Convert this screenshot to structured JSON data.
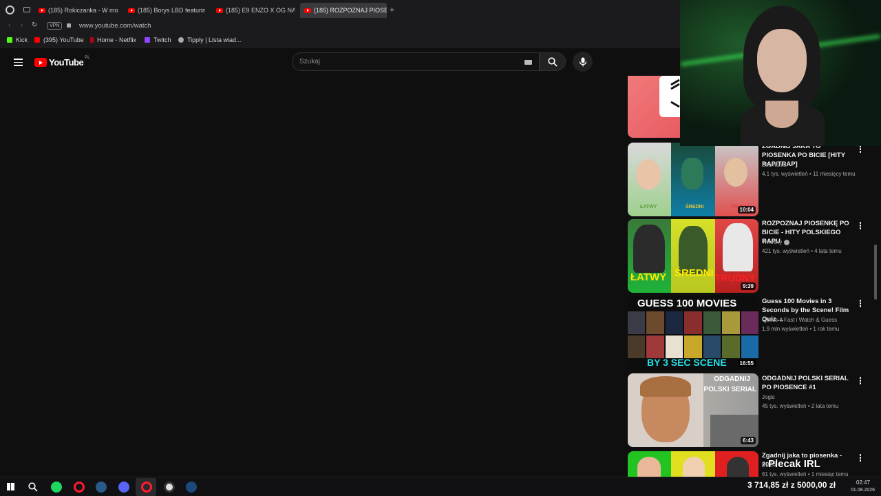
{
  "browser": {
    "tabs": [
      {
        "label": "(185) Rokiczanka - W moim"
      },
      {
        "label": "(185) Borys LBD featuring I"
      },
      {
        "label": "(185) E9 ENZO X OG NAFA"
      },
      {
        "label": "(185) ROZPOZNAJ PIOSEN"
      }
    ],
    "vpn_label": "VPN",
    "url": "www.youtube.com/watch",
    "bookmarks": [
      "Kick",
      "(395) YouTube",
      "Home - Netflix",
      "Twitch",
      "Tipply | Lista wiad..."
    ]
  },
  "youtube": {
    "logo_text": "YouTube",
    "region": "PL",
    "search_placeholder": "Szukaj"
  },
  "videos": [
    {
      "title": "ZGADNIJ JAKA TO PIOSENKA PO BICIE [HITY RAP/TRAP]",
      "channel": "Bitomania",
      "meta": "4,1 tys. wyświetleń • 11 miesięcy temu",
      "duration": "10:04",
      "thumb_labels": [
        "ŁATWY",
        "ŚREDNI",
        "TRUDNY"
      ]
    },
    {
      "title": "ROZPOZNAJ PIOSENKĘ PO BICIE - HITY POLSKIEGO RAPU",
      "channel": "Threeny",
      "meta": "421 tys. wyświetleń • 4 lata temu",
      "duration": "9:39",
      "thumb_labels": [
        "ŁATWY",
        "ŚREDNI",
        "TRUDNY"
      ]
    },
    {
      "title": "Guess 100 Movies in 3 Seconds by the Scene! Film Quiz ...",
      "channel": "Guess It Fast i Watch & Guess",
      "meta": "1,9 mln wyświetleń • 1 rok temu",
      "duration": "16:55",
      "thumb_labels": [
        "GUESS 100 MOVIES",
        "BY 3 SEC SCENE"
      ]
    },
    {
      "title": "ODGADNIJ POLSKI SERIAL PO PIOSENCE #1",
      "channel": "Jogis",
      "meta": "45 tys. wyświetleń • 2 lata temu",
      "duration": "6:43",
      "thumb_labels": [
        "ODGADNIJ",
        "POLSKI SERIAL"
      ]
    },
    {
      "title": "Zgadnij jaka to piosenka - 2025",
      "channel": "PM",
      "meta": "61 tys. wyświetleń • 1 miesiąc temu",
      "duration": "",
      "thumb_labels": []
    }
  ],
  "overlay": {
    "plecak": "Plecak IRL",
    "money": "3 714,85 zł z 5000,00 zł"
  },
  "taskbar": {
    "time": "02:47",
    "date": "01.08.2026"
  },
  "colors": {
    "youtube_red": "#ff0000",
    "background": "#0f0f0f",
    "text_secondary": "#aaaaaa"
  }
}
